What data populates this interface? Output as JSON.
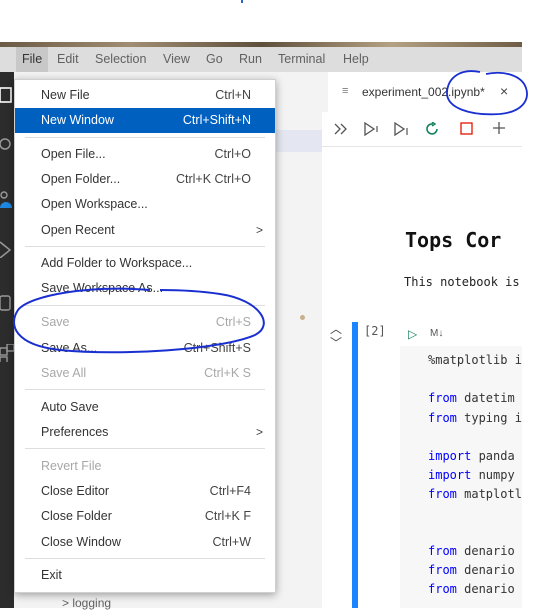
{
  "menubar": {
    "items": [
      "File",
      "Edit",
      "Selection",
      "View",
      "Go",
      "Run",
      "Terminal",
      "Help"
    ],
    "active": "File"
  },
  "file_menu": {
    "new_file": {
      "label": "New File",
      "shortcut": "Ctrl+N"
    },
    "new_window": {
      "label": "New Window",
      "shortcut": "Ctrl+Shift+N"
    },
    "open_file": {
      "label": "Open File...",
      "shortcut": "Ctrl+O"
    },
    "open_folder": {
      "label": "Open Folder...",
      "shortcut": "Ctrl+K Ctrl+O"
    },
    "open_workspace": {
      "label": "Open Workspace..."
    },
    "open_recent": {
      "label": "Open Recent"
    },
    "add_folder": {
      "label": "Add Folder to Workspace..."
    },
    "save_workspace_as": {
      "label": "Save Workspace As..."
    },
    "save": {
      "label": "Save",
      "shortcut": "Ctrl+S"
    },
    "save_as": {
      "label": "Save As...",
      "shortcut": "Ctrl+Shift+S"
    },
    "save_all": {
      "label": "Save All",
      "shortcut": "Ctrl+K S"
    },
    "auto_save": {
      "label": "Auto Save"
    },
    "preferences": {
      "label": "Preferences"
    },
    "revert_file": {
      "label": "Revert File"
    },
    "close_editor": {
      "label": "Close Editor",
      "shortcut": "Ctrl+F4"
    },
    "close_folder": {
      "label": "Close Folder",
      "shortcut": "Ctrl+K F"
    },
    "close_window": {
      "label": "Close Window",
      "shortcut": "Ctrl+W"
    },
    "exit": {
      "label": "Exit"
    }
  },
  "tab": {
    "filename": "experiment_002.ipynb*",
    "close_glyph": "×"
  },
  "toolbar": {
    "icons": [
      "run-all-icon",
      "run-above-icon",
      "run-below-icon",
      "restart-icon",
      "interrupt-icon",
      "add-cell-icon"
    ]
  },
  "notebook": {
    "title": "Tops Cor",
    "description": "This notebook is",
    "cell_number": "[2]",
    "cell_language": "M↓",
    "code": [
      {
        "kw": "",
        "rest": "%matplotlib i"
      },
      {
        "kw": "from",
        "rest": " datetim"
      },
      {
        "kw": "from",
        "rest": " typing i"
      },
      {
        "kw": "import",
        "rest": " panda"
      },
      {
        "kw": "import",
        "rest": " numpy"
      },
      {
        "kw": "from",
        "rest": " matplotl"
      },
      {
        "kw": "from",
        "rest": " denario"
      },
      {
        "kw": "from",
        "rest": " denario"
      },
      {
        "kw": "from",
        "rest": " denario"
      }
    ]
  },
  "explorer": {
    "logging_item": "> logging"
  },
  "colors": {
    "highlight": "#0060c0",
    "annotation": "#1a2fd0",
    "cell_indicator": "#1a85ff",
    "keyword": "#0000ff"
  }
}
